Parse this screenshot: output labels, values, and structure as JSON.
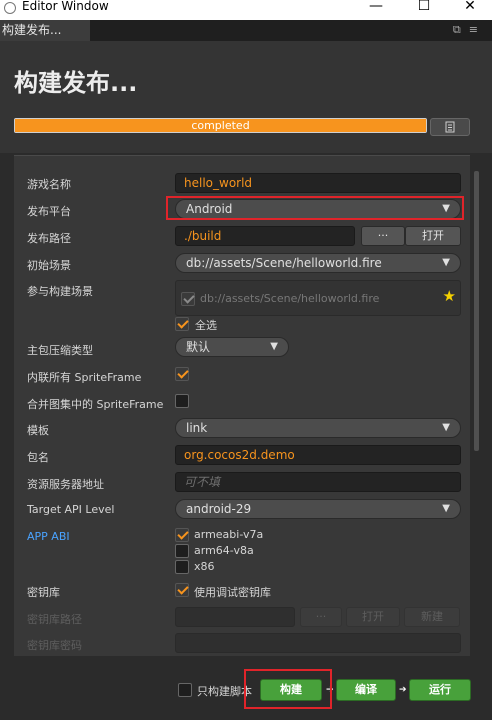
{
  "window": {
    "title": "Editor Window",
    "minimize": "—",
    "maximize": "☐",
    "close": "✕"
  },
  "tab": {
    "label": "构建发布..."
  },
  "header": {
    "title": "构建发布...",
    "progress_text": "completed",
    "progress_percent": 100
  },
  "form": {
    "game_name": {
      "label": "游戏名称",
      "value": "hello_world"
    },
    "platform": {
      "label": "发布平台",
      "value": "Android"
    },
    "build_path": {
      "label": "发布路径",
      "value": "./build",
      "browse": "···",
      "open": "打开"
    },
    "start_scene": {
      "label": "初始场景",
      "value": "db://assets/Scene/helloworld.fire"
    },
    "scenes": {
      "label": "参与构建场景",
      "item": "db://assets/Scene/helloworld.fire",
      "select_all": "全选"
    },
    "compression": {
      "label": "主包压缩类型",
      "value": "默认"
    },
    "inline_spriteframe": {
      "label": "内联所有 SpriteFrame"
    },
    "merge_spriteframe": {
      "label": "合并图集中的 SpriteFrame"
    },
    "template": {
      "label": "模板",
      "value": "link"
    },
    "package_name": {
      "label": "包名",
      "value": "org.cocos2d.demo"
    },
    "resource_server": {
      "label": "资源服务器地址",
      "placeholder": "可不填"
    },
    "target_api": {
      "label": "Target API Level",
      "value": "android-29"
    },
    "app_abi": {
      "label": "APP ABI",
      "options": [
        "armeabi-v7a",
        "arm64-v8a",
        "x86"
      ]
    },
    "keystore": {
      "label": "密钥库",
      "option": "使用调试密钥库"
    },
    "keystore_path": {
      "label": "密钥库路径",
      "browse": "···",
      "open": "打开",
      "new": "新建"
    },
    "keystore_password": {
      "label": "密钥库密码"
    }
  },
  "footer": {
    "build_script_only": "只构建脚本",
    "build": "构建",
    "compile": "编译",
    "run": "运行"
  },
  "colors": {
    "accent": "#f7941e",
    "green": "#48a13b",
    "highlight": "#e0242a",
    "link": "#4aa3ff"
  }
}
